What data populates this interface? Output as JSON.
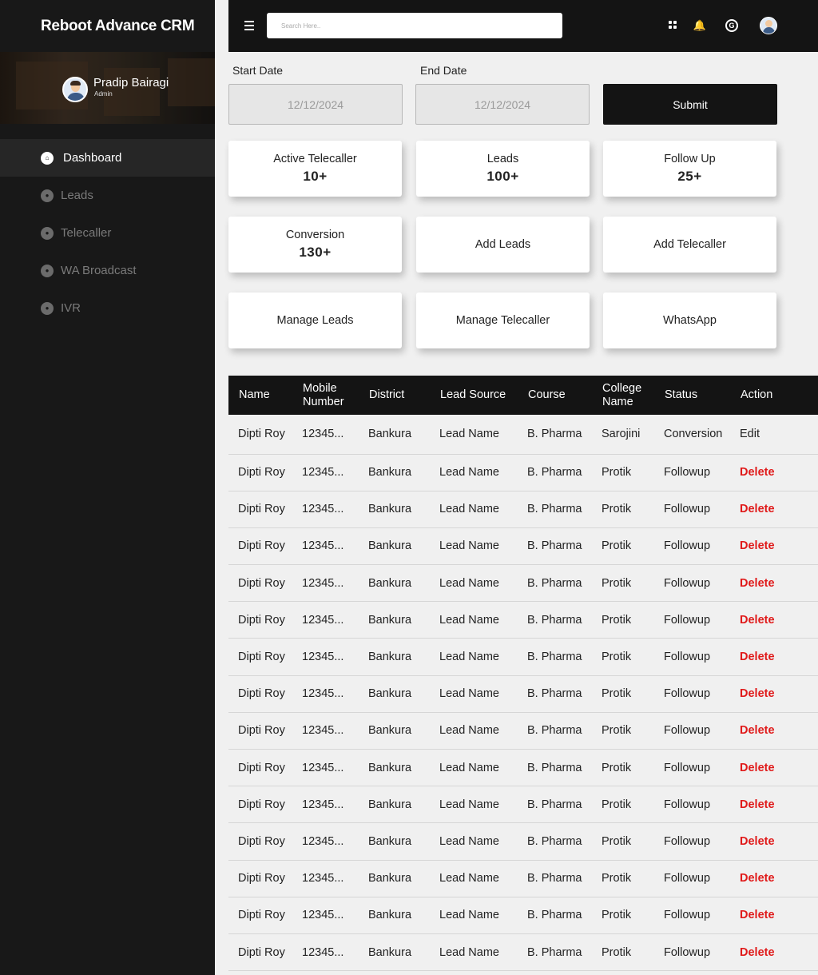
{
  "app": {
    "title": "Reboot Advance CRM"
  },
  "profile": {
    "name": "Pradip Bairagi",
    "role": "Admin"
  },
  "sidebar": {
    "items": [
      {
        "label": "Dashboard",
        "active": true
      },
      {
        "label": "Leads"
      },
      {
        "label": "Telecaller"
      },
      {
        "label": "WA Broadcast"
      },
      {
        "label": "IVR"
      }
    ]
  },
  "header": {
    "search_placeholder": "Search Here.."
  },
  "filters": {
    "start_label": "Start Date",
    "start_value": "12/12/2024",
    "end_label": "End Date",
    "end_value": "12/12/2024",
    "submit_label": "Submit"
  },
  "cards": [
    {
      "title": "Active Telecaller",
      "value": "10+"
    },
    {
      "title": "Leads",
      "value": "100+"
    },
    {
      "title": "Follow Up",
      "value": "25+"
    },
    {
      "title": "Conversion",
      "value": "130+"
    },
    {
      "title": "Add Leads",
      "value": ""
    },
    {
      "title": "Add Telecaller",
      "value": ""
    },
    {
      "title": "Manage Leads",
      "value": ""
    },
    {
      "title": "Manage Telecaller",
      "value": ""
    },
    {
      "title": "WhatsApp",
      "value": ""
    }
  ],
  "table": {
    "columns": [
      "Name",
      "Mobile Number",
      "District",
      "Lead Source",
      "Course",
      "College Name",
      "Status",
      "Action"
    ],
    "rows": [
      [
        "Dipti Roy",
        "12345...",
        "Bankura",
        "Lead Name",
        "B. Pharma",
        "Sarojini",
        "Conversion",
        "Edit"
      ],
      [
        "Dipti Roy",
        "12345...",
        "Bankura",
        "Lead Name",
        "B. Pharma",
        "Protik",
        "Followup",
        "Delete"
      ],
      [
        "Dipti Roy",
        "12345...",
        "Bankura",
        "Lead Name",
        "B. Pharma",
        "Protik",
        "Followup",
        "Delete"
      ],
      [
        "Dipti Roy",
        "12345...",
        "Bankura",
        "Lead Name",
        "B. Pharma",
        "Protik",
        "Followup",
        "Delete"
      ],
      [
        "Dipti Roy",
        "12345...",
        "Bankura",
        "Lead Name",
        "B. Pharma",
        "Protik",
        "Followup",
        "Delete"
      ],
      [
        "Dipti Roy",
        "12345...",
        "Bankura",
        "Lead Name",
        "B. Pharma",
        "Protik",
        "Followup",
        "Delete"
      ],
      [
        "Dipti Roy",
        "12345...",
        "Bankura",
        "Lead Name",
        "B. Pharma",
        "Protik",
        "Followup",
        "Delete"
      ],
      [
        "Dipti Roy",
        "12345...",
        "Bankura",
        "Lead Name",
        "B. Pharma",
        "Protik",
        "Followup",
        "Delete"
      ],
      [
        "Dipti Roy",
        "12345...",
        "Bankura",
        "Lead Name",
        "B. Pharma",
        "Protik",
        "Followup",
        "Delete"
      ],
      [
        "Dipti Roy",
        "12345...",
        "Bankura",
        "Lead Name",
        "B. Pharma",
        "Protik",
        "Followup",
        "Delete"
      ],
      [
        "Dipti Roy",
        "12345...",
        "Bankura",
        "Lead Name",
        "B. Pharma",
        "Protik",
        "Followup",
        "Delete"
      ],
      [
        "Dipti Roy",
        "12345...",
        "Bankura",
        "Lead Name",
        "B. Pharma",
        "Protik",
        "Followup",
        "Delete"
      ],
      [
        "Dipti Roy",
        "12345...",
        "Bankura",
        "Lead Name",
        "B. Pharma",
        "Protik",
        "Followup",
        "Delete"
      ],
      [
        "Dipti Roy",
        "12345...",
        "Bankura",
        "Lead Name",
        "B. Pharma",
        "Protik",
        "Followup",
        "Delete"
      ],
      [
        "Dipti Roy",
        "12345...",
        "Bankura",
        "Lead Name",
        "B. Pharma",
        "Protik",
        "Followup",
        "Delete"
      ]
    ]
  },
  "colors": {
    "dark": "#141414",
    "sidebar": "#181818",
    "danger": "#e01a1a",
    "background": "#f0f0f0"
  }
}
